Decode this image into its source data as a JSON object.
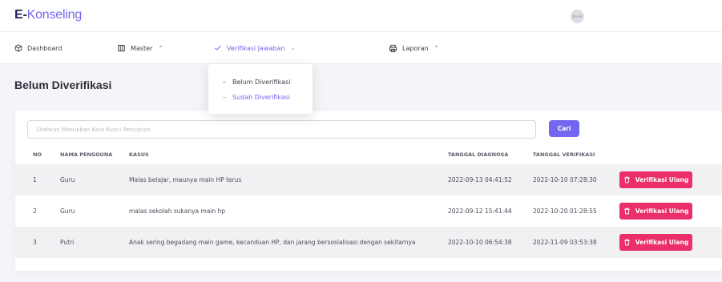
{
  "app": {
    "logo_prefix": "E-",
    "logo_name": "Konseling",
    "avatar_initials": "Ko-ka"
  },
  "menu": [
    {
      "label": "Dashboard",
      "icon": "package-icon"
    },
    {
      "label": "Master",
      "icon": "columns-icon",
      "chevron": "^"
    },
    {
      "label": "Verifikasi Jawaban",
      "icon": "check-icon",
      "chevron": "v",
      "active": true
    },
    {
      "label": "Laporan",
      "icon": "printer-icon",
      "chevron": "^"
    }
  ],
  "dropdown": {
    "items": [
      {
        "label": "Belum Diverifikasi",
        "prefix": "–"
      },
      {
        "label": "Sudah Diverifikasi",
        "prefix": "–",
        "selected": true
      }
    ]
  },
  "page": {
    "title": "Belum Diverifikasi"
  },
  "search": {
    "placeholder": "Silahkan Masukkan Kata Kunci Pencarian",
    "button_label": "Cari"
  },
  "table": {
    "headers": [
      "NO",
      "NAMA PENGGUNA",
      "KASUS",
      "TANGGAL DIAGNOSA",
      "TANGGAL VERIFIKASI"
    ],
    "action_label": "Verifikasi Ulang",
    "rows": [
      {
        "no": "1",
        "user": "Guru",
        "kasus": "Malas belajar, maunya main HP terus",
        "tgl_diagnosa": "2022-09-13 04:41:52",
        "tgl_verifikasi": "2022-10-10 07:28:30"
      },
      {
        "no": "2",
        "user": "Guru",
        "kasus": "malas sekolah sukanya main hp",
        "tgl_diagnosa": "2022-09-12 15:41:44",
        "tgl_verifikasi": "2022-10-20 01:28:55"
      },
      {
        "no": "3",
        "user": "Putri",
        "kasus": "Anak sering begadang main game, kecanduan HP, dan jarang bersosialisasi dengan sekitarnya",
        "tgl_diagnosa": "2022-10-10 06:54:38",
        "tgl_verifikasi": "2022-11-09 03:53:38"
      }
    ]
  },
  "colors": {
    "primary": "#7367f0",
    "danger": "#ea2f6b",
    "brand_dark": "#1e2456"
  }
}
